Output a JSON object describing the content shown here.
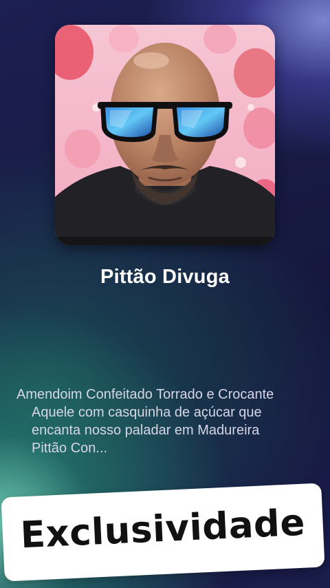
{
  "profile": {
    "name": "Pittão Divuga",
    "avatar_icon": "profile-photo"
  },
  "description": {
    "lines": [
      "Amendoim Confeitado Torrado e Crocante",
      "Aquele com casquinha de açúcar que",
      "encanta nosso paladar em Madureira",
      "Pittão Con..."
    ]
  },
  "banner": {
    "label": "Exclusividade"
  },
  "colors": {
    "background_dark": "#181a44",
    "glow_green": "#78dcbe",
    "glow_blue": "#8c96e6",
    "banner_bg": "#ffffff",
    "banner_text": "#111111"
  }
}
